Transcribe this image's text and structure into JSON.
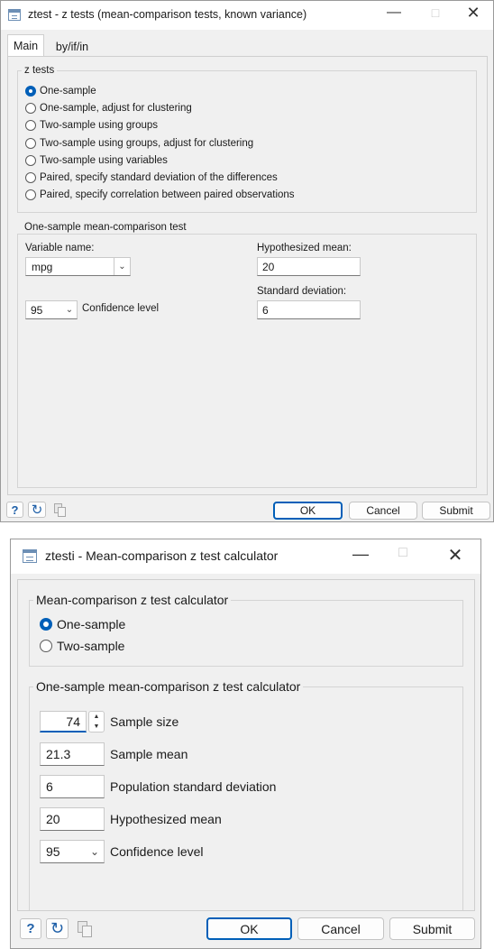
{
  "ztest": {
    "title": "ztest - z tests (mean-comparison tests, known variance)",
    "tabs": [
      {
        "label": "Main"
      },
      {
        "label": "by/if/in"
      }
    ],
    "ztests_group": {
      "label": "z tests",
      "options": [
        {
          "label": "One-sample",
          "checked": true
        },
        {
          "label": "One-sample, adjust for clustering",
          "checked": false
        },
        {
          "label": "Two-sample using groups",
          "checked": false
        },
        {
          "label": "Two-sample using groups, adjust for clustering",
          "checked": false
        },
        {
          "label": "Two-sample using variables",
          "checked": false
        },
        {
          "label": "Paired, specify standard deviation of the differences",
          "checked": false
        },
        {
          "label": "Paired, specify correlation between paired observations",
          "checked": false
        }
      ]
    },
    "one_sample_group": {
      "label": "One-sample mean-comparison test",
      "variable_name_label": "Variable name:",
      "variable_name_value": "mpg",
      "hyp_mean_label": "Hypothesized mean:",
      "hyp_mean_value": "20",
      "std_dev_label": "Standard deviation:",
      "std_dev_value": "6",
      "conf_value": "95",
      "conf_label": "Confidence level"
    },
    "buttons": {
      "ok": "OK",
      "cancel": "Cancel",
      "submit": "Submit"
    }
  },
  "ztesti": {
    "title": "ztesti - Mean-comparison z test calculator",
    "calc_group": {
      "label": "Mean-comparison z test calculator",
      "options": [
        {
          "label": "One-sample",
          "checked": true
        },
        {
          "label": "Two-sample",
          "checked": false
        }
      ]
    },
    "one_sample_group": {
      "label": "One-sample mean-comparison z test calculator",
      "sample_size_value": "74",
      "sample_size_label": "Sample size",
      "sample_mean_value": "21.3",
      "sample_mean_label": "Sample mean",
      "pop_sd_value": "6",
      "pop_sd_label": "Population standard deviation",
      "hyp_mean_value": "20",
      "hyp_mean_label": "Hypothesized mean",
      "conf_value": "95",
      "conf_label": "Confidence level"
    },
    "buttons": {
      "ok": "OK",
      "cancel": "Cancel",
      "submit": "Submit"
    }
  },
  "colors": {
    "accent": "#005fb8",
    "window_bg": "#f0f0f0"
  }
}
